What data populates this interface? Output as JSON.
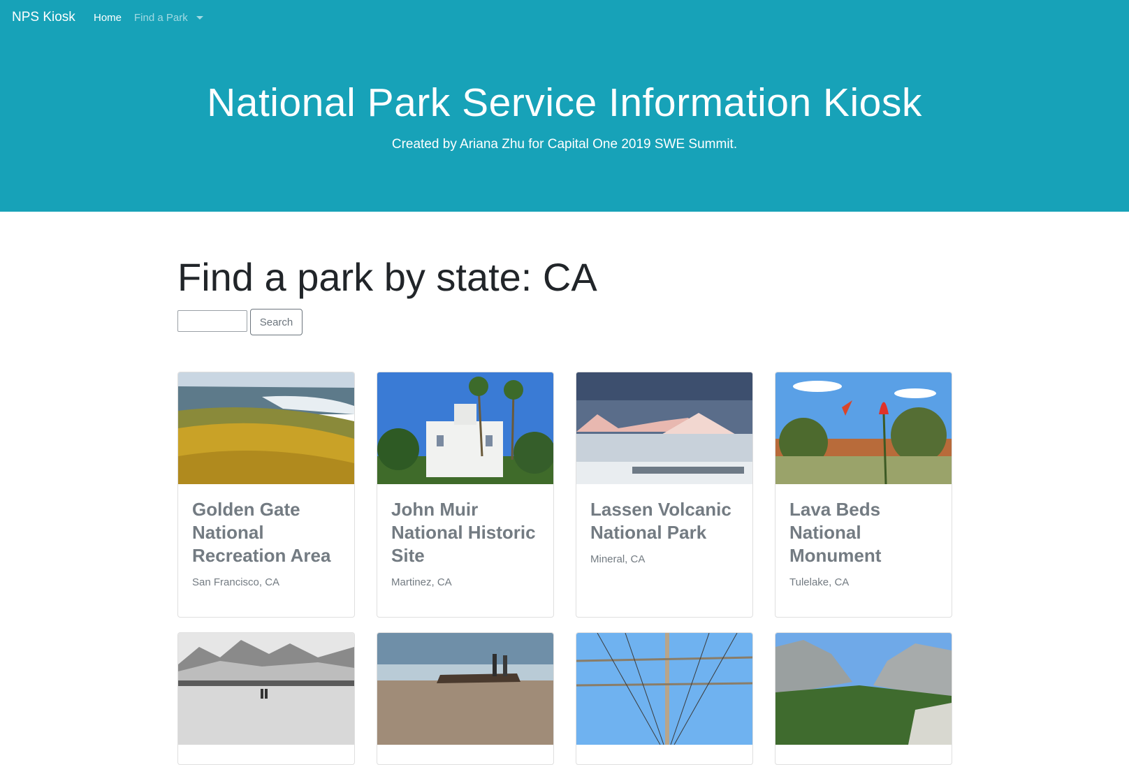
{
  "navbar": {
    "brand": "NPS Kiosk",
    "home": "Home",
    "find_a_park": "Find a Park"
  },
  "hero": {
    "title": "National Park Service Information Kiosk",
    "subtitle": "Created by Ariana Zhu for Capital One 2019 SWE Summit."
  },
  "search": {
    "heading": "Find a park by state: CA",
    "input_value": "",
    "button_label": "Search"
  },
  "parks": [
    {
      "name": "Golden Gate National Recreation Area",
      "location": "San Francisco, CA"
    },
    {
      "name": "John Muir National Historic Site",
      "location": "Martinez, CA"
    },
    {
      "name": "Lassen Volcanic National Park",
      "location": "Mineral, CA"
    },
    {
      "name": "Lava Beds National Monument",
      "location": "Tulelake, CA"
    }
  ],
  "colors": {
    "primary": "#17a2b8",
    "card_text": "#737b82",
    "button_border": "#6c757d"
  }
}
